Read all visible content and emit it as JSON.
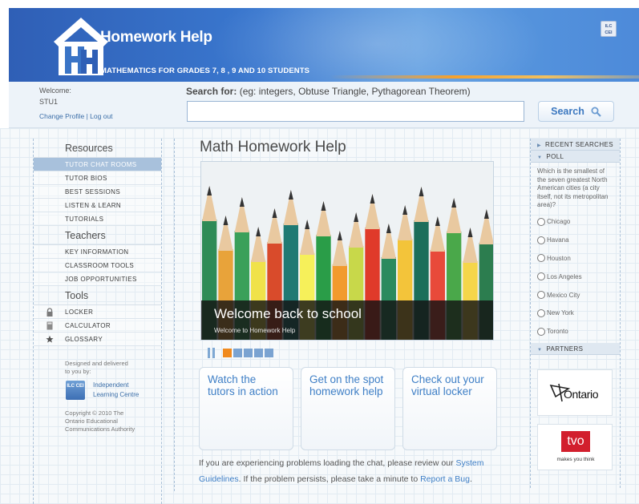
{
  "header": {
    "site_title": "Homework Help",
    "subtitle": "MATHEMATICS FOR GRADES 7, 8 , 9 AND 10 STUDENTS",
    "badge": "ILC\nCEI"
  },
  "user": {
    "welcome": "Welcome:",
    "username": "STU1",
    "change_profile": "Change Profile",
    "separator": " | ",
    "logout": "Log out"
  },
  "search": {
    "label_bold": "Search for:",
    "label_hint": " (eg: integers, Obtuse Triangle, Pythagorean Theorem)",
    "value": "",
    "button": "Search"
  },
  "sidebar": {
    "resources_heading": "Resources",
    "resources": [
      "TUTOR CHAT ROOMS",
      "TUTOR BIOS",
      "BEST SESSIONS",
      "LISTEN & LEARN",
      "TUTORIALS"
    ],
    "teachers_heading": "Teachers",
    "teachers": [
      "KEY INFORMATION",
      "CLASSROOM TOOLS",
      "JOB OPPORTUNITIES"
    ],
    "tools_heading": "Tools",
    "tools": [
      "LOCKER",
      "CALCULATOR",
      "GLOSSARY"
    ],
    "designed_by": "Designed and delivered to you by:",
    "ilc_logo": "ILC CEI",
    "ilc_name": "Independent Learning Centre",
    "copyright": "Copyright © 2010 The Ontario Educational Communications Authority"
  },
  "main": {
    "title": "Math Homework Help",
    "hero_title": "Welcome back to school",
    "hero_subtitle": "Welcome to Homework Help",
    "slider_active_index": 0,
    "cards": [
      "Watch the tutors in action",
      "Get on the spot homework help",
      "Check out your virtual locker"
    ],
    "notice_1": "If you are experiencing problems loading the chat, please review our ",
    "notice_link1": "System Guidelines",
    "notice_2": ". If the problem persists, please take a minute to ",
    "notice_link2": "Report a Bug",
    "notice_3": "."
  },
  "right_panel": {
    "recent_searches": "RECENT SEARCHES",
    "poll": "POLL",
    "poll_question": "Which is the smallest of the seven greatest North American cities (a city itself, not its metropolitan area)?",
    "poll_options": [
      "Chicago",
      "Havana",
      "Houston",
      "Los Angeles",
      "Mexico City",
      "New York",
      "Toronto"
    ],
    "partners": "PARTNERS",
    "partner_ontario": "Ontario",
    "partner_tvo": "tvo",
    "partner_tvo_tagline": "makes you think"
  },
  "colors": {
    "accent_blue": "#3f7fc6",
    "active_nav": "#a8c1dc",
    "slider_active": "#f08a1e"
  }
}
